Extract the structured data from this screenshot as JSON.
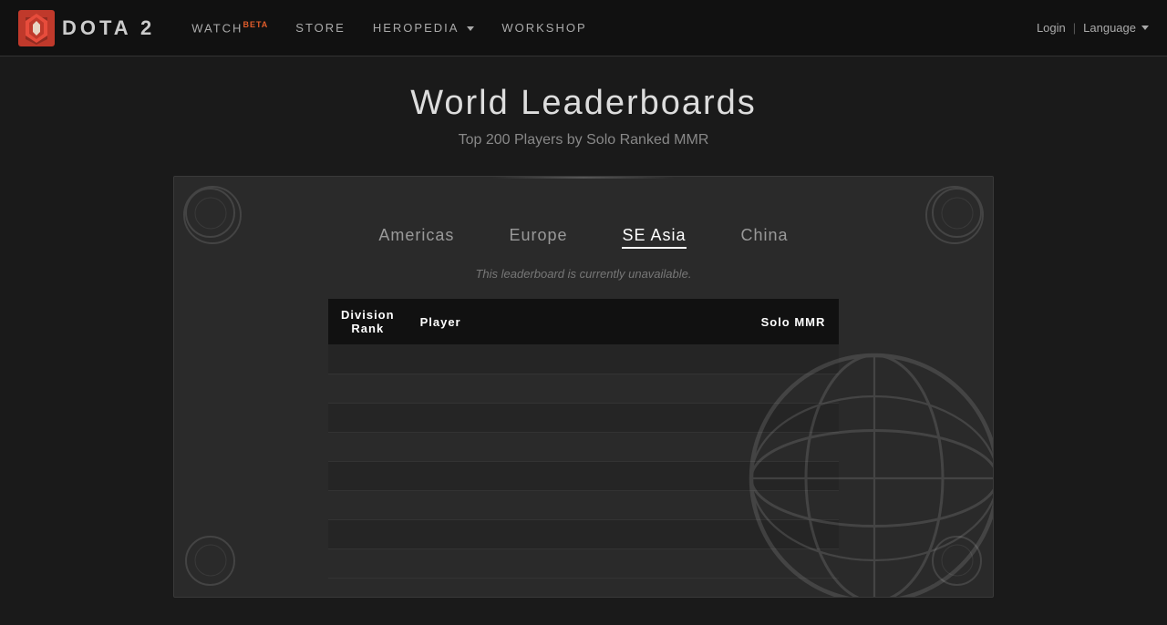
{
  "nav": {
    "logo_text": "DOTA 2",
    "watch_label": "WATCH",
    "watch_badge": "BETA",
    "store_label": "STORE",
    "heropedia_label": "HEROPEDIA",
    "workshop_label": "WORKSHOP",
    "login_label": "Login",
    "language_label": "Language"
  },
  "page": {
    "title": "World Leaderboards",
    "subtitle": "Top 200 Players by Solo Ranked MMR"
  },
  "regions": [
    {
      "id": "americas",
      "label": "Americas",
      "active": false
    },
    {
      "id": "europe",
      "label": "Europe",
      "active": false
    },
    {
      "id": "se-asia",
      "label": "SE Asia",
      "active": true
    },
    {
      "id": "china",
      "label": "China",
      "active": false
    }
  ],
  "table": {
    "col_rank": "Division\nRank",
    "col_player": "Player",
    "col_mmr": "Solo MMR",
    "unavailable_msg": "This leaderboard is currently unavailable.",
    "rows": [
      {
        "rank": "",
        "player": "",
        "mmr": ""
      },
      {
        "rank": "",
        "player": "",
        "mmr": ""
      },
      {
        "rank": "",
        "player": "",
        "mmr": ""
      },
      {
        "rank": "",
        "player": "",
        "mmr": ""
      },
      {
        "rank": "",
        "player": "",
        "mmr": ""
      },
      {
        "rank": "",
        "player": "",
        "mmr": ""
      },
      {
        "rank": "",
        "player": "",
        "mmr": ""
      },
      {
        "rank": "",
        "player": "",
        "mmr": ""
      }
    ]
  }
}
